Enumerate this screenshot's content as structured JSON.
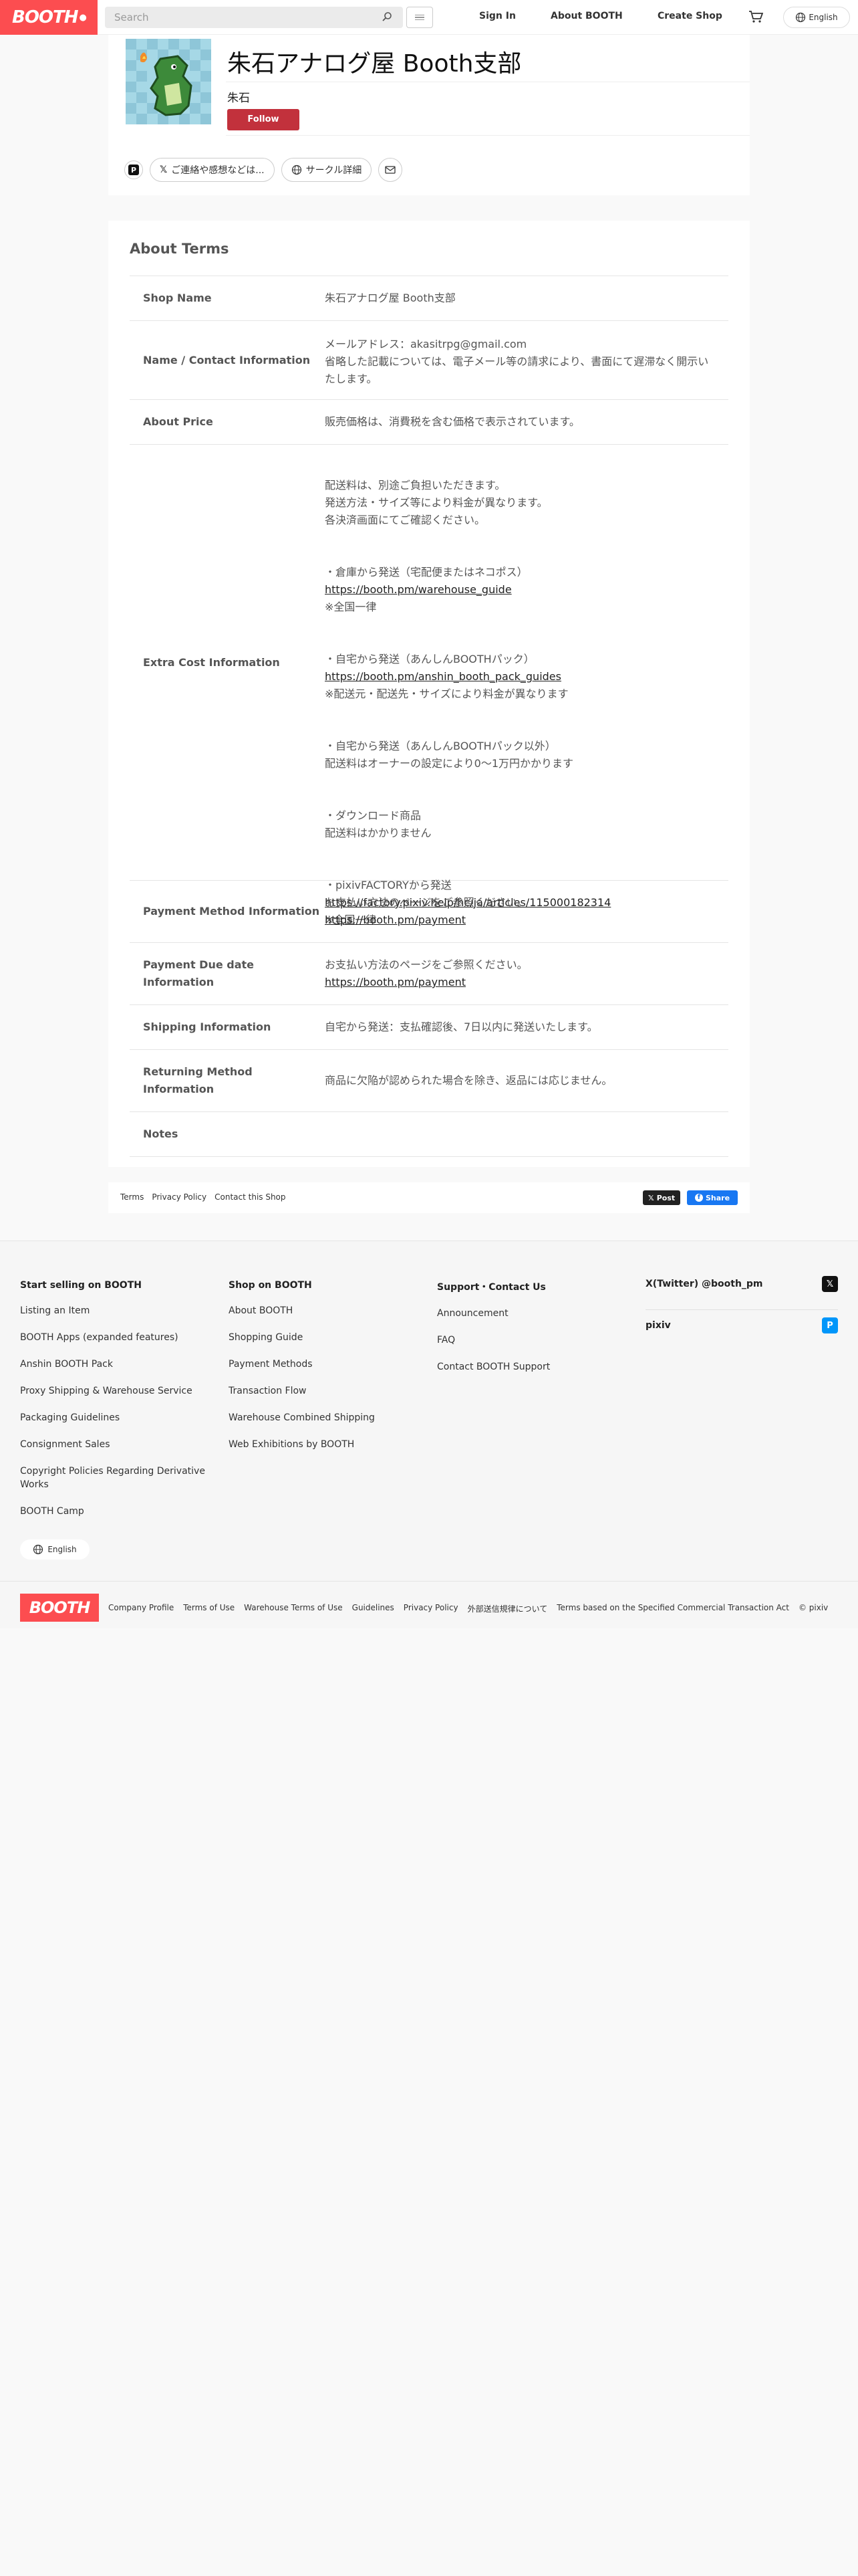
{
  "header": {
    "logo": "BOOTH",
    "search_placeholder": "Search",
    "nav": [
      "Sign In",
      "About BOOTH",
      "Create Shop"
    ],
    "language": "English"
  },
  "shop": {
    "title": "朱石アナログ屋 Booth支部",
    "owner": "朱石",
    "follow_label": "Follow",
    "contact_pill": "ご連絡や感想などは...",
    "circle_pill": "サークル詳細"
  },
  "terms": {
    "heading": "About Terms",
    "rows": [
      {
        "label": "Shop Name",
        "value": "朱石アナログ屋 Booth支部"
      },
      {
        "label": "Name / Contact Information",
        "value": "メールアドレス：akasitrpg@gmail.com\n省略した記載については、電子メール等の請求により、書面にて遅滞なく開示いたします。"
      },
      {
        "label": "About Price",
        "value": "販売価格は、消費税を含む価格で表示されています。"
      },
      {
        "label": "Extra Cost Information",
        "p1": "配送料は、別途ご負担いただきます。\n発送方法・サイズ等により料金が異なります。\n各決済画面にてご確認ください。",
        "p2a": "・倉庫から発送（宅配便またはネコポス）",
        "p2link": "https://booth.pm/warehouse_guide",
        "p2b": "※全国一律",
        "p3a": "・自宅から発送（あんしんBOOTHパック）",
        "p3link": "https://booth.pm/anshin_booth_pack_guides",
        "p3b": "※配送元・配送先・サイズにより料金が異なります",
        "p4": "・自宅から発送（あんしんBOOTHパック以外）\n配送料はオーナーの設定により0〜1万円かかります",
        "p5": "・ダウンロード商品\n配送料はかかりません",
        "p6a": "・pixivFACTORYから発送",
        "p6link": "https://factory.pixiv.help/hc/ja/articles/115000182314",
        "p6b": "※全国一律"
      },
      {
        "label": "Payment Method Information",
        "value": "お支払い方法のページをご参照ください。",
        "link": "https://booth.pm/payment"
      },
      {
        "label": "Payment Due date Information",
        "value": "お支払い方法のページをご参照ください。",
        "link": "https://booth.pm/payment"
      },
      {
        "label": "Shipping Information",
        "value": "自宅から発送：支払確認後、7日以内に発送いたします。"
      },
      {
        "label": "Returning Method Information",
        "value": "商品に欠陥が認められた場合を除き、返品には応じません。"
      },
      {
        "label": "Notes",
        "value": ""
      }
    ]
  },
  "share": {
    "links": [
      "Terms",
      "Privacy Policy",
      "Contact this Shop"
    ],
    "post": "Post",
    "share": "Share"
  },
  "footer": {
    "col1": {
      "title": "Start selling on BOOTH",
      "items": [
        "Listing an Item",
        "BOOTH Apps (expanded features)",
        "Anshin BOOTH Pack",
        "Proxy Shipping & Warehouse Service",
        "Packaging Guidelines",
        "Consignment Sales",
        "Copyright Policies Regarding Derivative Works",
        "BOOTH Camp"
      ]
    },
    "col2": {
      "title": "Shop on BOOTH",
      "items": [
        "About BOOTH",
        "Shopping Guide",
        "Payment Methods",
        "Transaction Flow",
        "Warehouse Combined Shipping",
        "Web Exhibitions by BOOTH"
      ]
    },
    "col3": {
      "title": "Support・Contact Us",
      "items": [
        "Announcement",
        "FAQ",
        "Contact BOOTH Support"
      ]
    },
    "twitter": "X(Twitter) @booth_pm",
    "pixiv": "pixiv",
    "language": "English",
    "bottom_links": [
      "Company Profile",
      "Terms of Use",
      "Warehouse Terms of Use",
      "Guidelines",
      "Privacy Policy",
      "外部送信規律について",
      "Terms based on the Specified Commercial Transaction Act",
      "© pixiv"
    ]
  }
}
